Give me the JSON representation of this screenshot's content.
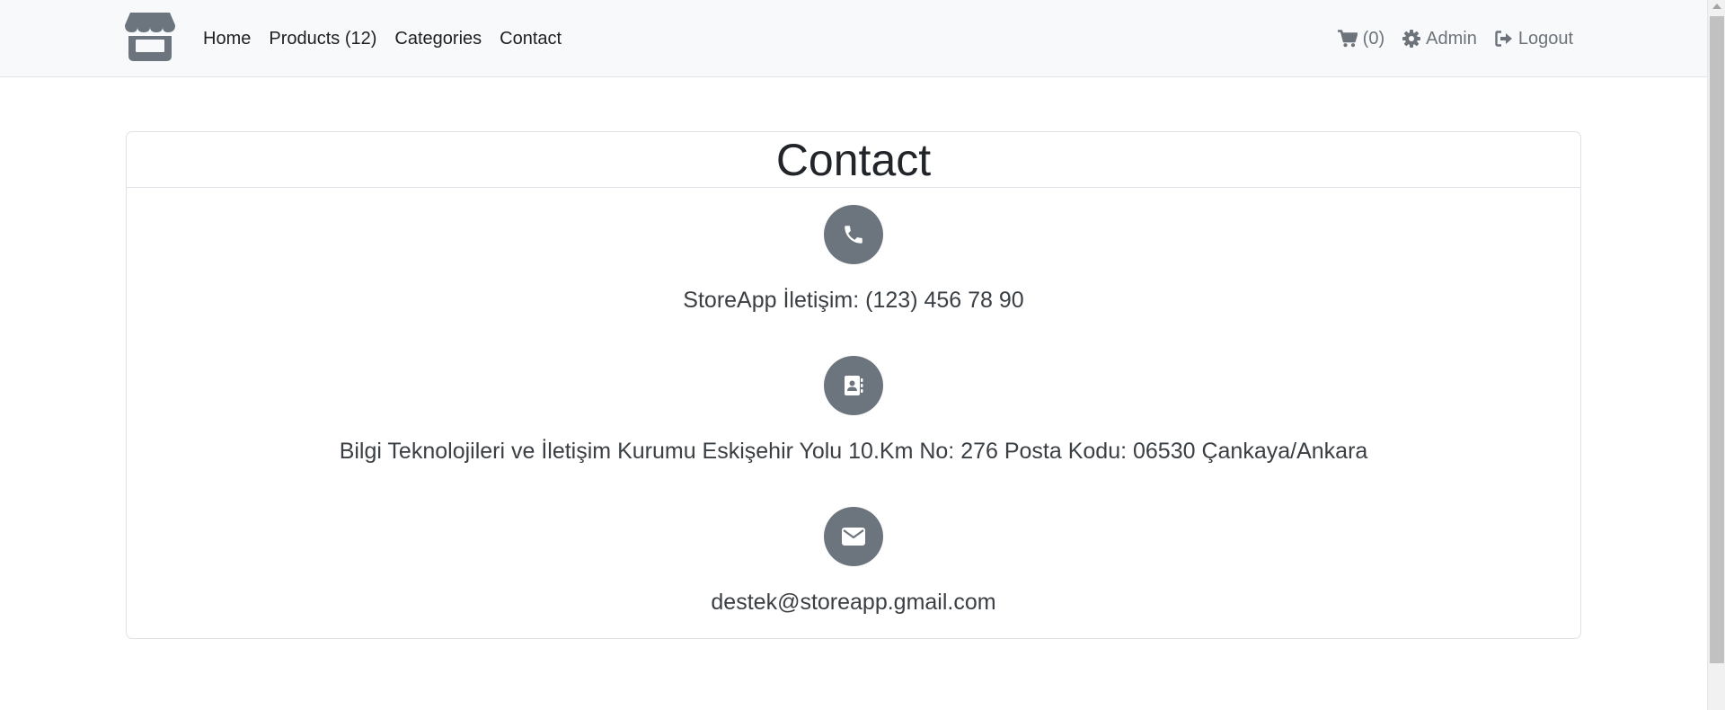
{
  "nav": {
    "logo_icon": "store-icon",
    "links": [
      "Home",
      "Products (12)",
      "Categories",
      "Contact"
    ],
    "cart": {
      "icon": "cart-icon",
      "label": "(0)"
    },
    "admin": {
      "icon": "gear-icon",
      "label": "Admin"
    },
    "logout": {
      "icon": "sign-out-icon",
      "label": "Logout"
    }
  },
  "card": {
    "title": "Contact",
    "phone": {
      "icon": "phone-icon",
      "text": "StoreApp İletişim: (123) 456 78 90"
    },
    "address": {
      "icon": "address-book-icon",
      "text": "Bilgi Teknolojileri ve İletişim Kurumu Eskişehir Yolu 10.Km No: 276 Posta Kodu: 06530 Çankaya/Ankara"
    },
    "email": {
      "icon": "envelope-icon",
      "text": "destek@storeapp.gmail.com"
    }
  },
  "colors": {
    "navbar_bg": "#f8f9fa",
    "icon_circle": "#6c757d",
    "muted_text": "#6c737a"
  }
}
